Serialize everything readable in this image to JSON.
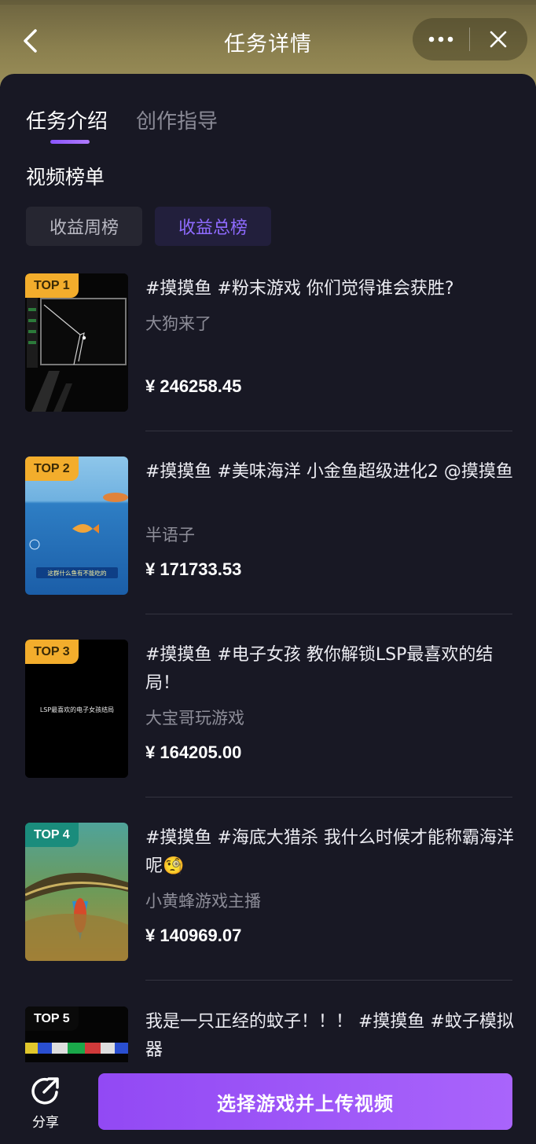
{
  "header": {
    "title": "任务详情",
    "back_icon": "back-arrow-icon",
    "more_icon": "more-dots-icon",
    "close_icon": "close-icon"
  },
  "tabs": [
    {
      "label": "任务介绍",
      "active": true
    },
    {
      "label": "创作指导",
      "active": false
    }
  ],
  "section_title": "视频榜单",
  "filters": [
    {
      "label": "收益周榜",
      "active": false
    },
    {
      "label": "收益总榜",
      "active": true
    }
  ],
  "items": [
    {
      "rank": "TOP 1",
      "title": "#摸摸鱼 #粉末游戏 你们觉得谁会获胜?",
      "author": "大狗来了",
      "price": "¥ 246258.45"
    },
    {
      "rank": "TOP 2",
      "title": "#摸摸鱼 #美味海洋 小金鱼超级进化2 @摸摸鱼",
      "author": "半语子",
      "price": "¥ 171733.53",
      "thumb_caption": "这群什么鱼有不能吃的"
    },
    {
      "rank": "TOP 3",
      "title": "#摸摸鱼 #电子女孩 教你解锁LSP最喜欢的结局！",
      "author": "大宝哥玩游戏",
      "price": "¥ 164205.00",
      "thumb_caption": "LSP最喜欢的电子女孩结局"
    },
    {
      "rank": "TOP 4",
      "title": "#摸摸鱼 #海底大猎杀 我什么时候才能称霸海洋呢🧐",
      "author": "小黄蜂游戏主播",
      "price": "¥ 140969.07"
    },
    {
      "rank": "TOP 5",
      "title": "我是一只正经的蚊子！！！ #摸摸鱼 #蚊子模拟器",
      "author": "",
      "price": ""
    }
  ],
  "bottom": {
    "share_label": "分享",
    "share_icon": "share-icon",
    "cta_label": "选择游戏并上传视频"
  }
}
